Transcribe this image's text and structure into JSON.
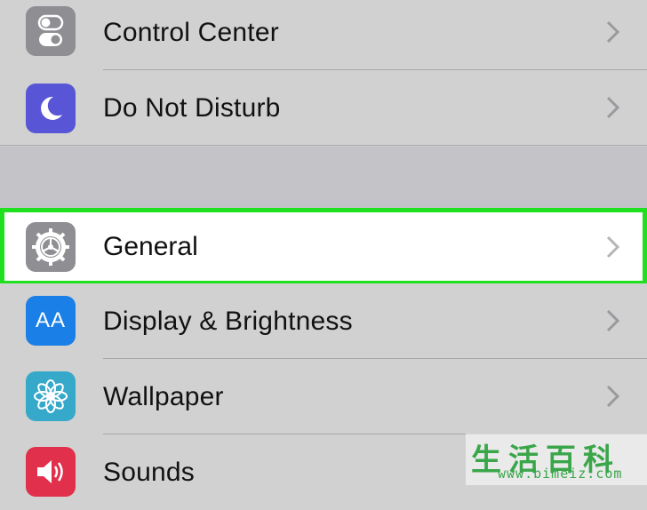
{
  "settings": {
    "items": [
      {
        "label": "Control Center",
        "icon": "toggle-switches-icon",
        "color": "#8e8e93"
      },
      {
        "label": "Do Not Disturb",
        "icon": "moon-icon",
        "color": "#5856d6"
      },
      {
        "label": "General",
        "icon": "gear-icon",
        "color": "#8e8e93",
        "highlighted": true
      },
      {
        "label": "Display & Brightness",
        "icon": "text-size-icon",
        "color": "#1a7fe6"
      },
      {
        "label": "Wallpaper",
        "icon": "flower-icon",
        "color": "#36a8c9"
      },
      {
        "label": "Sounds",
        "icon": "speaker-icon",
        "color": "#e0304b"
      }
    ],
    "display_icon_text": "AA"
  },
  "watermark": {
    "chinese": "生活百科",
    "url": "www.bimeiz.com"
  },
  "colors": {
    "highlight_border": "#1fe01f",
    "row_background": "#d1d1d1",
    "section_gap": "#c4c4c8"
  }
}
